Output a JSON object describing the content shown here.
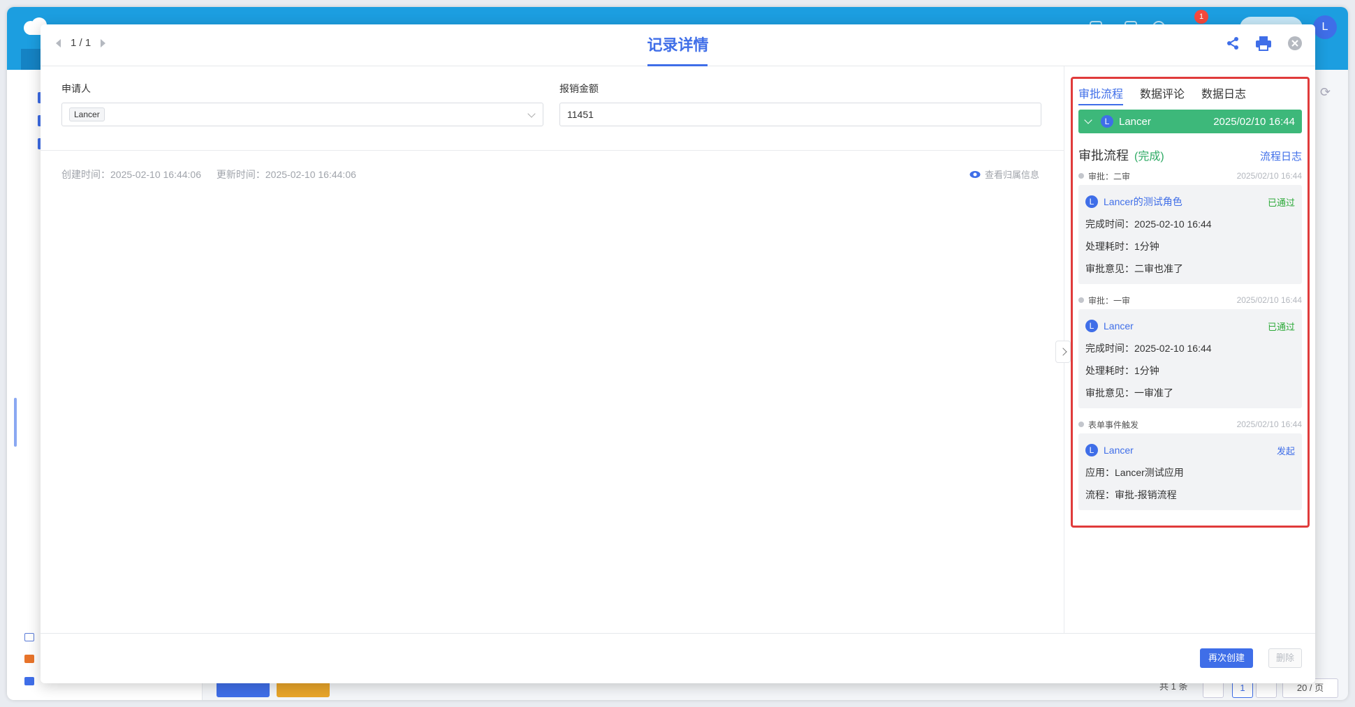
{
  "modal": {
    "title": "记录详情",
    "pager": "1 / 1"
  },
  "form": {
    "applicant_label": "申请人",
    "applicant_value": "Lancer",
    "amount_label": "报销金额",
    "amount_value": "11451"
  },
  "meta": {
    "created": "创建时间：2025-02-10 16:44:06",
    "updated": "更新时间：2025-02-10 16:44:06",
    "view_owner": "查看归属信息"
  },
  "panel": {
    "tabs": [
      "审批流程",
      "数据评论",
      "数据日志"
    ],
    "approver_bar": {
      "avatar": "L",
      "name": "Lancer",
      "time": "2025/02/10 16:44"
    },
    "flow_title": "审批流程",
    "flow_status": "(完成)",
    "flow_log": "流程日志",
    "nodes": [
      {
        "title": "审批：二审",
        "time": "2025/02/10 16:44",
        "avatar": "L",
        "name": "Lancer的测试角色",
        "status": "已通过",
        "rows": [
          "完成时间：2025-02-10 16:44",
          "处理耗时：1分钟",
          "审批意见：二审也准了"
        ]
      },
      {
        "title": "审批：一审",
        "time": "2025/02/10 16:44",
        "avatar": "L",
        "name": "Lancer",
        "status": "已通过",
        "rows": [
          "完成时间：2025-02-10 16:44",
          "处理耗时：1分钟",
          "审批意见：一审准了"
        ]
      },
      {
        "title": "表单事件触发",
        "time": "2025/02/10 16:44",
        "avatar": "L",
        "name": "Lancer",
        "status": "发起",
        "rows": [
          "应用：Lancer测试应用",
          "流程：审批-报销流程"
        ]
      }
    ]
  },
  "footer": {
    "recreate": "再次创建",
    "delete": "删除"
  },
  "background": {
    "notification_count": "1",
    "user_avatar": "L",
    "pager_total": "共 1 条",
    "page_num": "1",
    "page_size": "20 / 页"
  },
  "colors": {
    "accent": "#3f6ee8",
    "header": "#1c9ee0",
    "success": "#3db87a",
    "highlight": "#e03b3b"
  }
}
